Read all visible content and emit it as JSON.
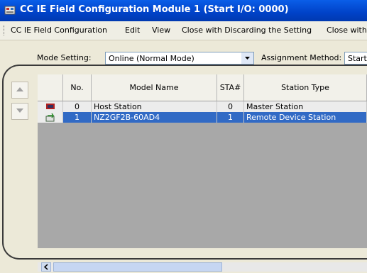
{
  "window": {
    "title": "CC IE Field Configuration Module 1 (Start I/O: 0000)"
  },
  "menu": [
    "CC IE Field Configuration",
    "Edit",
    "View",
    "Close with Discarding the Setting",
    "Close with"
  ],
  "settings": {
    "mode_label": "Mode Setting:",
    "mode_value": "Online (Normal Mode)",
    "assignment_label": "Assignment Method:",
    "assignment_value": "Start,"
  },
  "table": {
    "headers": [
      "No.",
      "Model Name",
      "STA#",
      "Station Type"
    ],
    "rows": [
      {
        "no": "0",
        "model": "Host Station",
        "sta": "0",
        "type": "Master Station",
        "icon": "host-station-icon"
      },
      {
        "no": "1",
        "model": "NZ2GF2B-60AD4",
        "sta": "1",
        "type": "Remote Device Station",
        "icon": "remote-device-icon"
      }
    ]
  }
}
